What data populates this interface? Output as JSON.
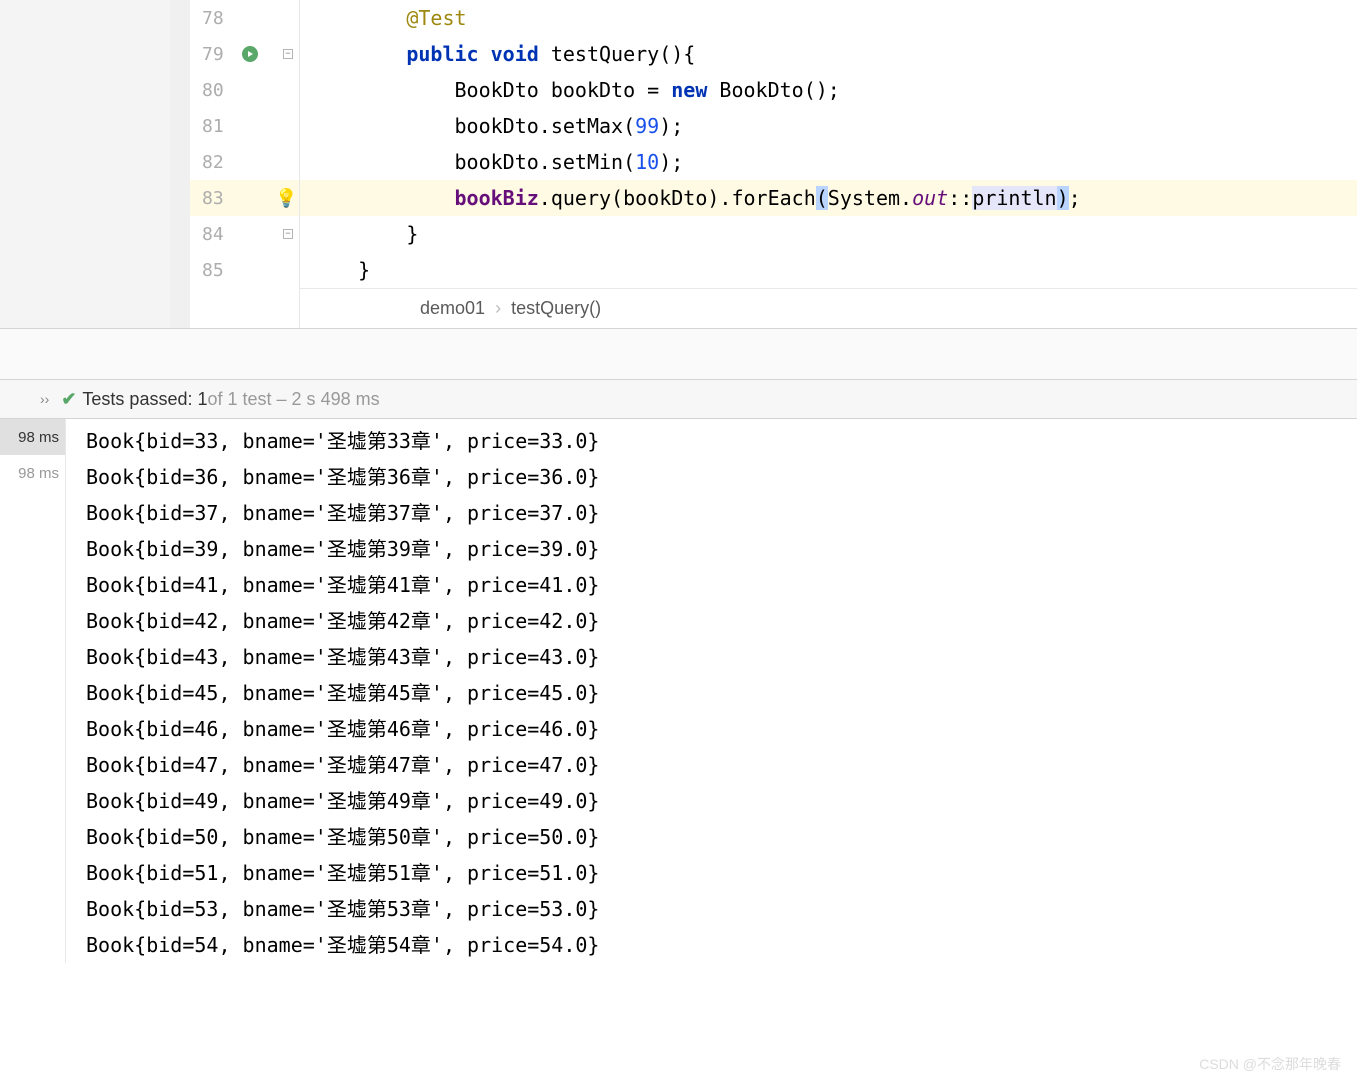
{
  "editor": {
    "line_numbers": [
      "78",
      "79",
      "80",
      "81",
      "82",
      "83",
      "84",
      "85"
    ],
    "current_line_index": 5,
    "code": {
      "l78": {
        "indent": "        ",
        "annotation": "@Test"
      },
      "l79": {
        "indent": "        ",
        "kw1": "public",
        "kw2": "void",
        "method": "testQuery",
        "after": "(){"
      },
      "l80": {
        "indent": "            ",
        "type1": "BookDto ",
        "var": "bookDto = ",
        "kw": "new",
        "type2": " BookDto();"
      },
      "l81": {
        "indent": "            ",
        "pre": "bookDto.setMax(",
        "num": "99",
        "post": ");"
      },
      "l82": {
        "indent": "            ",
        "pre": "bookDto.setMin(",
        "num": "10",
        "post": ");"
      },
      "l83": {
        "indent": "            ",
        "field": "bookBiz",
        "call1": ".query(bookDto).forEach",
        "p1": "(",
        "sys": "System.",
        "out": "out",
        "ref": "::",
        "println": "println",
        "p2": ")",
        "semi": ";"
      },
      "l84": {
        "indent": "        ",
        "brace": "}"
      },
      "l85": {
        "indent": "    ",
        "brace": "}"
      }
    }
  },
  "breadcrumb": {
    "item1": "demo01",
    "item2": "testQuery()"
  },
  "test_status": {
    "passed_label": "Tests passed: ",
    "passed_count": "1 ",
    "detail": "of 1 test – 2 s 498 ms"
  },
  "sidebar": {
    "item1": "98 ms",
    "item2": "98 ms"
  },
  "console": {
    "lines": [
      "Book{bid=33, bname='圣墟第33章', price=33.0}",
      "Book{bid=36, bname='圣墟第36章', price=36.0}",
      "Book{bid=37, bname='圣墟第37章', price=37.0}",
      "Book{bid=39, bname='圣墟第39章', price=39.0}",
      "Book{bid=41, bname='圣墟第41章', price=41.0}",
      "Book{bid=42, bname='圣墟第42章', price=42.0}",
      "Book{bid=43, bname='圣墟第43章', price=43.0}",
      "Book{bid=45, bname='圣墟第45章', price=45.0}",
      "Book{bid=46, bname='圣墟第46章', price=46.0}",
      "Book{bid=47, bname='圣墟第47章', price=47.0}",
      "Book{bid=49, bname='圣墟第49章', price=49.0}",
      "Book{bid=50, bname='圣墟第50章', price=50.0}",
      "Book{bid=51, bname='圣墟第51章', price=51.0}",
      "Book{bid=53, bname='圣墟第53章', price=53.0}",
      "Book{bid=54, bname='圣墟第54章', price=54.0}"
    ]
  },
  "watermark": "CSDN @不念那年晚春"
}
